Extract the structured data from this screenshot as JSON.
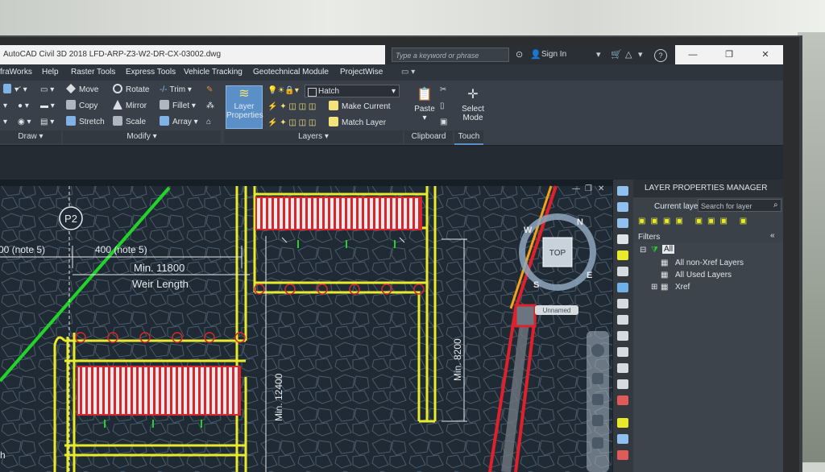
{
  "window": {
    "title": "AutoCAD Civil 3D 2018   LFD-ARP-Z3-W2-DR-CX-03002.dwg",
    "search_placeholder": "Type a keyword or phrase",
    "sign_in": "Sign In",
    "help_icon": "?",
    "minimize": "—",
    "restore": "❐",
    "close": "✕"
  },
  "menu": [
    "fraWorks",
    "Help",
    "Raster Tools",
    "Express Tools",
    "Vehicle Tracking",
    "Geotechnical Module",
    "ProjectWise"
  ],
  "ribbon": {
    "draw_title": "Draw ▾",
    "modify": {
      "move": "Move",
      "rotate": "Rotate",
      "trim": "Trim ▾",
      "copy": "Copy",
      "mirror": "Mirror",
      "fillet": "Fillet ▾",
      "stretch": "Stretch",
      "scale": "Scale",
      "array": "Array ▾",
      "title": "Modify ▾"
    },
    "layers": {
      "layer_properties_line1": "Layer",
      "layer_properties_line2": "Properties",
      "current_layer": "Hatch",
      "make_current": "Make Current",
      "match_layer": "Match Layer",
      "title": "Layers ▾"
    },
    "clipboard": {
      "paste": "Paste",
      "title": "Clipboard"
    },
    "touch": {
      "select_line1": "Select",
      "select_line2": "Mode",
      "title": "Touch"
    }
  },
  "drawing": {
    "p2_label": "P2",
    "dim_note_left": "00 (note 5)",
    "dim_note_mid": "400 (note 5)",
    "min_11800": "Min. 11800",
    "weir_length": "Weir Length",
    "min_12400": "Min. 12400",
    "min_8200": "Min. 8200",
    "bottom_left": "h"
  },
  "viewcube": {
    "top": "TOP",
    "north": "N",
    "east": "E",
    "south": "S",
    "west": "W",
    "ucs": "Unnamed"
  },
  "layer_manager": {
    "title": "LAYER PROPERTIES MANAGER",
    "current_layer": "Current layer",
    "search_placeholder": "Search for layer",
    "filters": "Filters",
    "tree": [
      "All",
      "All non-Xref Layers",
      "All Used Layers",
      "Xref"
    ]
  },
  "colors": {
    "drawing_bg": "#1f2a35",
    "ribbon_bg": "#3a4049",
    "active_button": "#5a8fc8",
    "yellow_lines": "#e8ea2a",
    "red_lines": "#e0202a",
    "green_line": "#22d42a"
  }
}
